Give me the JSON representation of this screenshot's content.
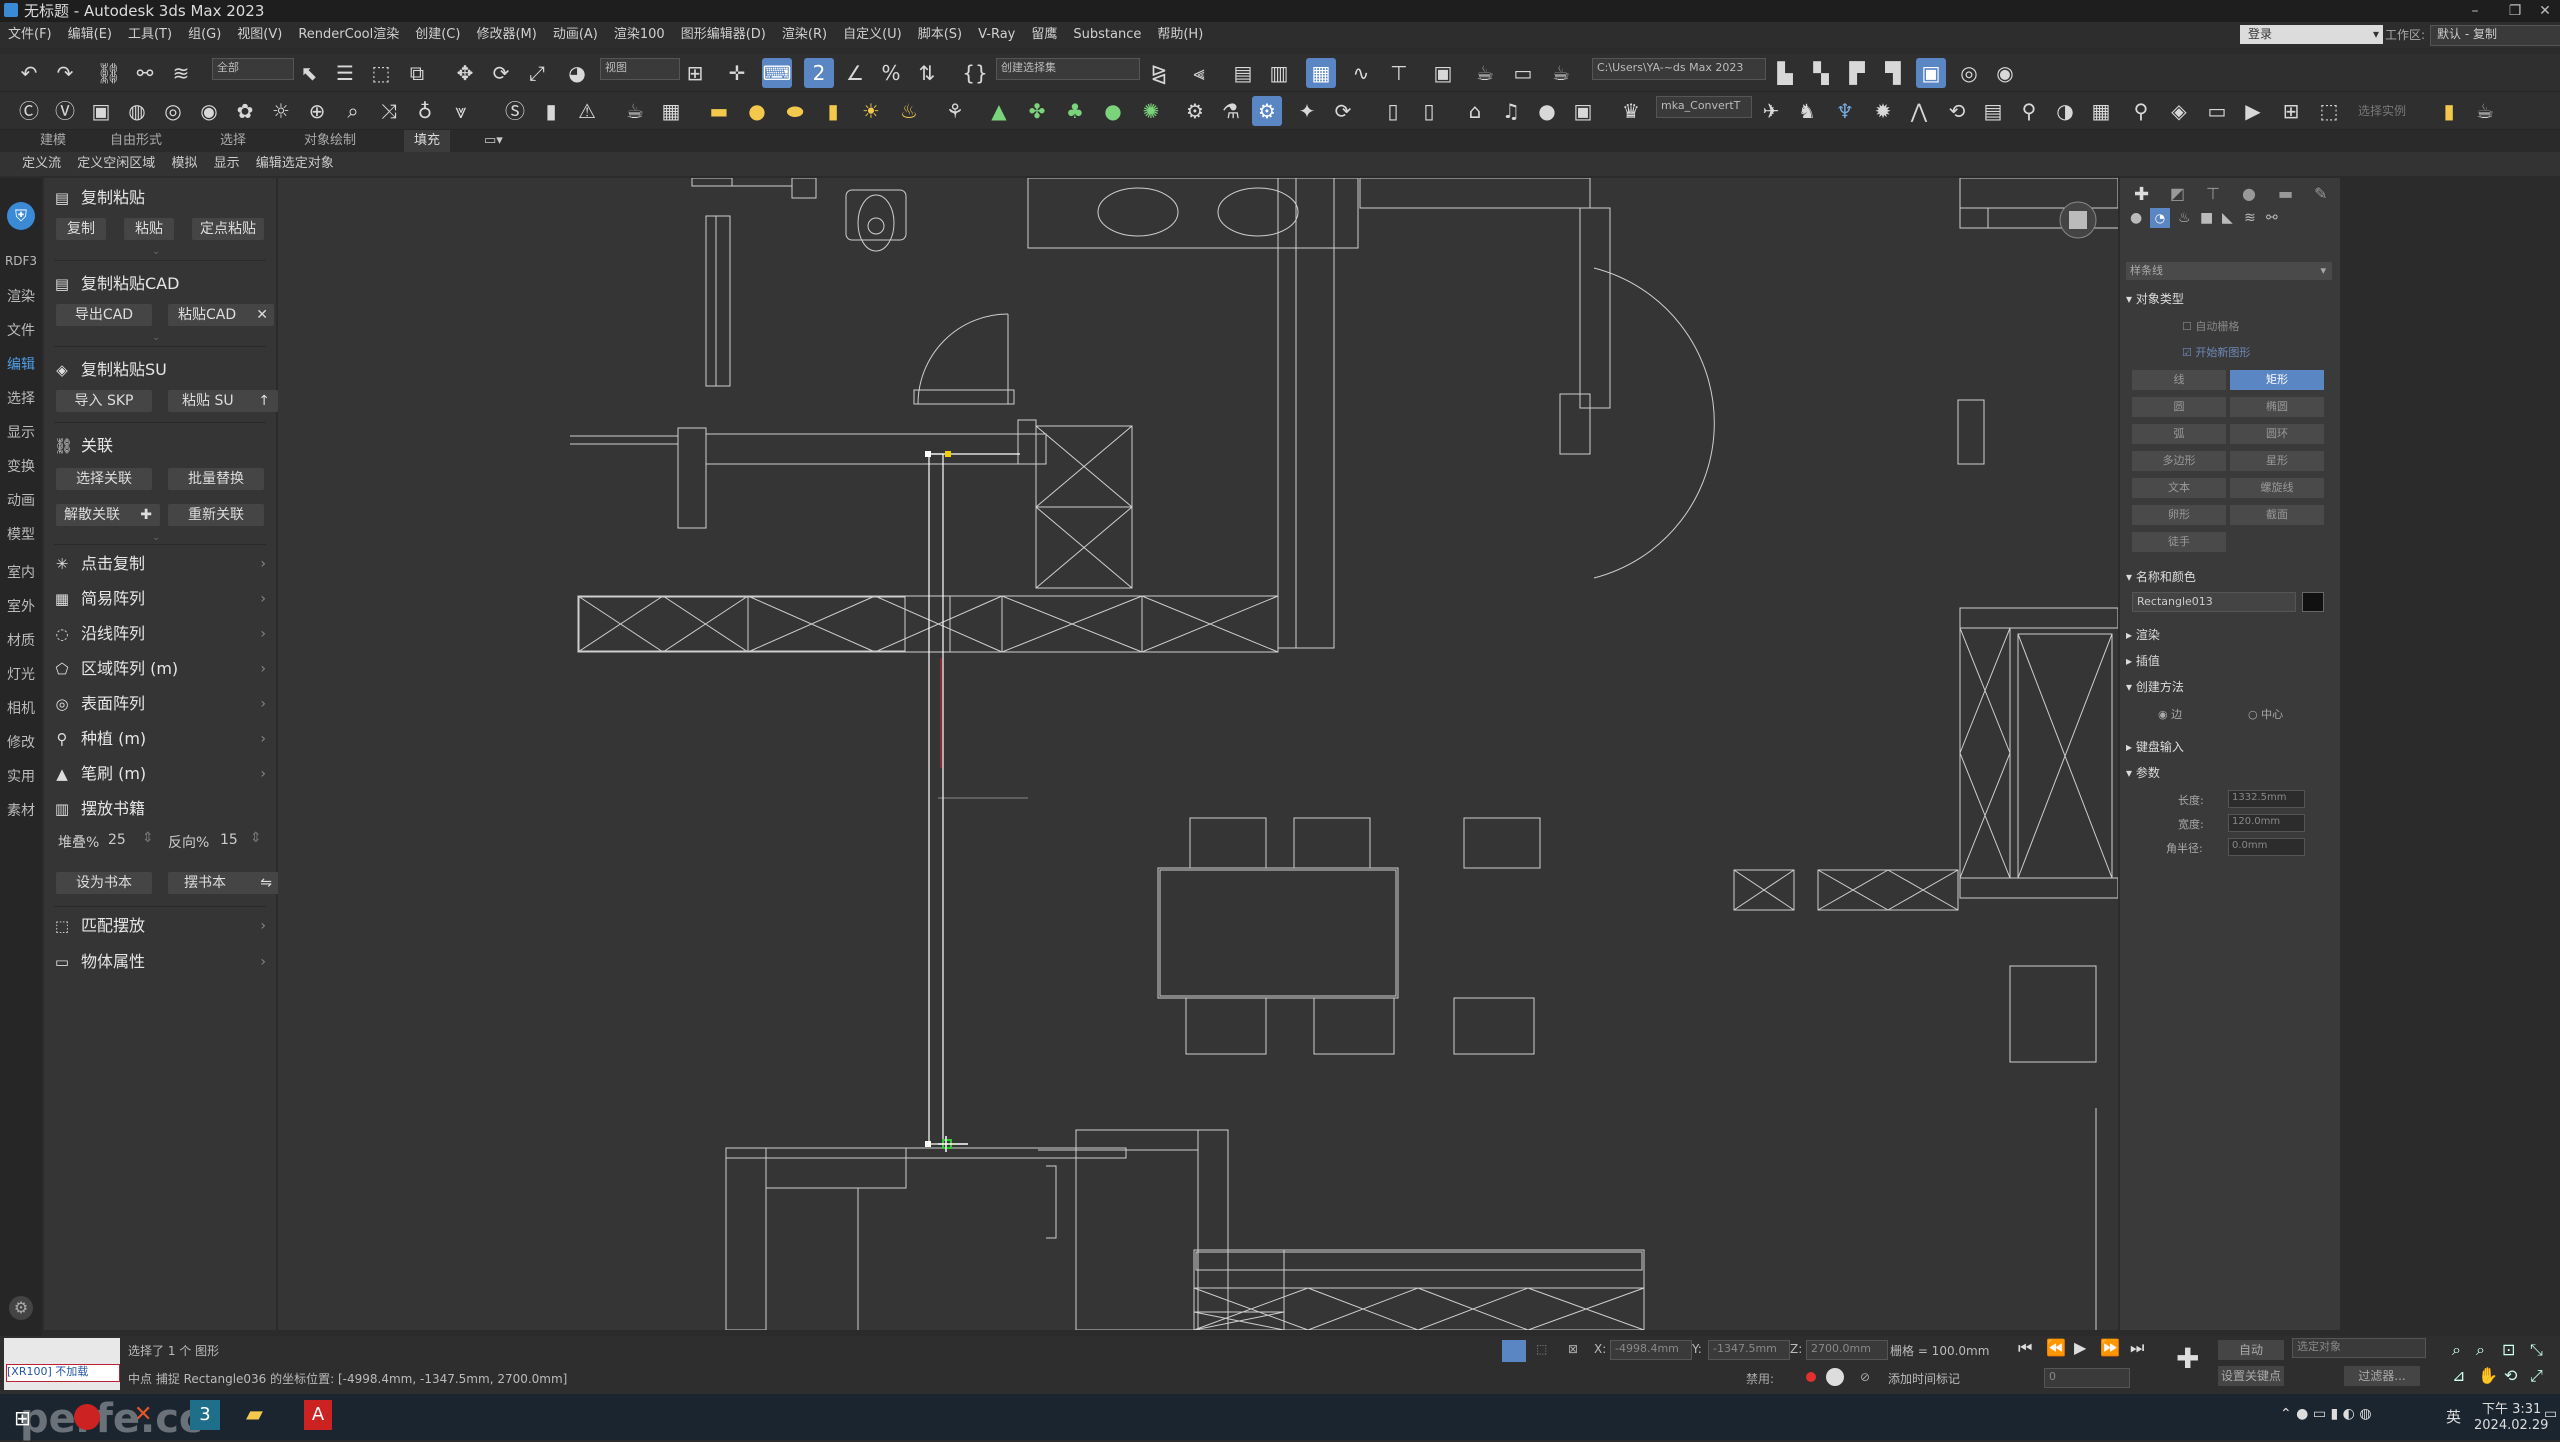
{
  "window": {
    "title": "无标题 - Autodesk 3ds Max 2023"
  },
  "menu": [
    "文件(F)",
    "编辑(E)",
    "工具(T)",
    "组(G)",
    "视图(V)",
    "RenderCool渲染",
    "创建(C)",
    "修改器(M)",
    "动画(A)",
    "渲染100",
    "图形编辑器(D)",
    "渲染(R)",
    "自定义(U)",
    "脚本(S)",
    "V-Ray",
    "留鹰",
    "Substance",
    "帮助(H)"
  ],
  "login": {
    "label": "登录",
    "workspace_label": "工作区:",
    "workspace_value": "默认 - 复制"
  },
  "toolbar": {
    "selection_filter": "全部",
    "view_dropdown": "视图",
    "named_selection": "创建选择集",
    "path": "C:\\Users\\YA-~ds Max 2023",
    "plugin_field": "mka_ConvertT",
    "select_instance": "选择实例"
  },
  "ribbon": {
    "tabs": [
      "建模",
      "自由形式",
      "选择",
      "对象绘制",
      "填充"
    ],
    "active_tab": "填充",
    "sub": [
      "定义流",
      "定义空闲区域",
      "模拟",
      "显示",
      "编辑选定对象"
    ]
  },
  "left_tabs": [
    "RDF3",
    "渲染",
    "文件",
    "编辑",
    "选择",
    "显示",
    "变换",
    "动画",
    "模型",
    "室内",
    "室外",
    "材质",
    "灯光",
    "相机",
    "修改",
    "实用",
    "素材"
  ],
  "left_tab_active": "编辑",
  "panel": {
    "copy_paste": {
      "title": "复制粘贴",
      "buttons": [
        "复制",
        "粘贴",
        "定点粘贴"
      ]
    },
    "copy_paste_cad": {
      "title": "复制粘贴CAD",
      "buttons": [
        "导出CAD",
        "粘贴CAD"
      ]
    },
    "copy_paste_su": {
      "title": "复制粘贴SU",
      "buttons": [
        "导入 SKP",
        "粘贴 SU"
      ]
    },
    "link": {
      "title": "关联",
      "buttons": [
        "选择关联",
        "批量替换",
        "解散关联",
        "重新关联"
      ]
    },
    "menu_items": [
      "点击复制",
      "简易阵列",
      "沿线阵列",
      "区域阵列 (m)",
      "表面阵列",
      "种植 (m)",
      "笔刷 (m)",
      "摆放书籍"
    ],
    "books": {
      "stack_label": "堆叠%",
      "stack_value": "25",
      "reverse_label": "反向%",
      "reverse_value": "15",
      "set_book": "设为书本",
      "place_book": "摆书本"
    },
    "bottom_items": [
      "匹配摆放",
      "物体属性"
    ]
  },
  "command_panel": {
    "dropdown": "样条线",
    "object_type": {
      "title": "对象类型",
      "auto_grid": "自动栅格",
      "start_new_shape": "开始新图形",
      "buttons": [
        "线",
        "矩形",
        "圆",
        "椭圆",
        "弧",
        "圆环",
        "多边形",
        "星形",
        "文本",
        "螺旋线",
        "卵形",
        "截面",
        "徒手"
      ],
      "active": "矩形"
    },
    "name_color": {
      "title": "名称和颜色",
      "name": "Rectangle013",
      "color": "#111111"
    },
    "render": "渲染",
    "interp": "插值",
    "creation": {
      "title": "创建方法",
      "edge": "边",
      "center": "中心"
    },
    "keyboard": "键盘输入",
    "params": {
      "title": "参数",
      "length_label": "长度:",
      "length": "1332.5mm",
      "width_label": "宽度:",
      "width": "120.0mm",
      "corner_label": "角半径:",
      "corner": "0.0mm"
    }
  },
  "status": {
    "selected": "选择了 1 个 图形",
    "prompt": "中点 捕捉 Rectangle036 的坐标位置: [-4998.4mm, -1347.5mm, 2700.0mm]",
    "maxscript": "[XR100] 不加载",
    "x_label": "X:",
    "x": "-4998.4mm",
    "y_label": "Y:",
    "y": "-1347.5mm",
    "z_label": "Z:",
    "z": "2700.0mm",
    "grid": "栅格 = 100.0mm",
    "disabled": "禁用:",
    "add_tag": "添加时间标记",
    "auto": "自动",
    "selected_obj": "选定对象",
    "set_key": "设置关键点",
    "filter": "过滤器...",
    "frame": "0"
  },
  "taskbar": {
    "time": "下午 3:31",
    "date": "2024.02.29",
    "lang": "英",
    "watermark": "perfe.cc"
  }
}
